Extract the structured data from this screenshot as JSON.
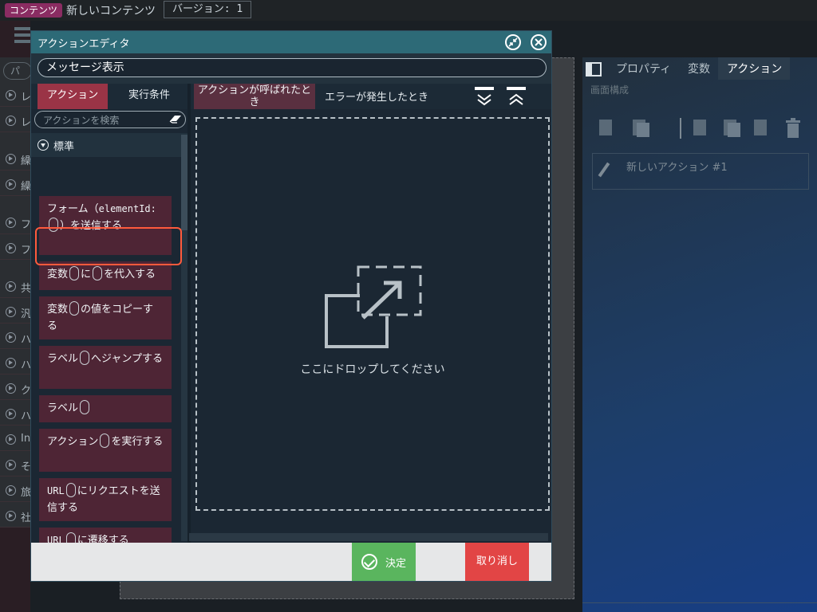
{
  "topbar": {
    "tag": "コンテンツ",
    "title": "新しいコンテンツ",
    "version": "バージョン: 1"
  },
  "background": {
    "left_search": "パ",
    "left_rows": [
      "レ",
      "レ",
      "繰",
      "繰",
      "フ",
      "フ",
      "共",
      "汎",
      "ハ",
      "ハ",
      "ク",
      "ハ",
      "In",
      "そ",
      "旅",
      "社"
    ],
    "right_panel": {
      "tabs": [
        "プロパティ",
        "変数",
        "アクション"
      ],
      "active_tab": "アクション",
      "section": "画面構成",
      "action_item": "新しいアクション #1"
    }
  },
  "modal": {
    "title": "アクションエディタ",
    "name_value": "メッセージ表示",
    "left_tabs": {
      "action": "アクション",
      "condition": "実行条件"
    },
    "search_placeholder": "アクションを検索",
    "category": "標準",
    "actions": [
      {
        "parts": [
          "フォーム（",
          "elementId:",
          "SLOT",
          "）を送信する"
        ]
      },
      {
        "parts": [
          "変数",
          "SLOT",
          "に",
          "SLOT",
          "を代入する"
        ]
      },
      {
        "parts": [
          "変数",
          "SLOT",
          "の値をコピーする"
        ]
      },
      {
        "parts": [
          "ラベル",
          "SLOT",
          "へジャンプする"
        ]
      },
      {
        "parts": [
          "ラベル",
          "SLOT"
        ]
      },
      {
        "parts": [
          "アクション",
          "SLOT",
          "を実行する"
        ]
      },
      {
        "parts": [
          "URL",
          "SLOT",
          "にリクエストを送信する"
        ]
      },
      {
        "parts": [
          "URL",
          "SLOT",
          "に遷移する"
        ]
      }
    ],
    "right_tabs": {
      "on_called": "アクションが呼ばれたとき",
      "on_error": "エラーが発生したとき"
    },
    "drop_text": "ここにドロップしてください",
    "ok_label": "決定",
    "cancel_label": "取り消し"
  },
  "colors": {
    "accent": "#9a3446",
    "title_bar": "#2d6a77",
    "ok": "#5ab55e",
    "cancel": "#e24545",
    "highlight": "#ff5a3c"
  }
}
